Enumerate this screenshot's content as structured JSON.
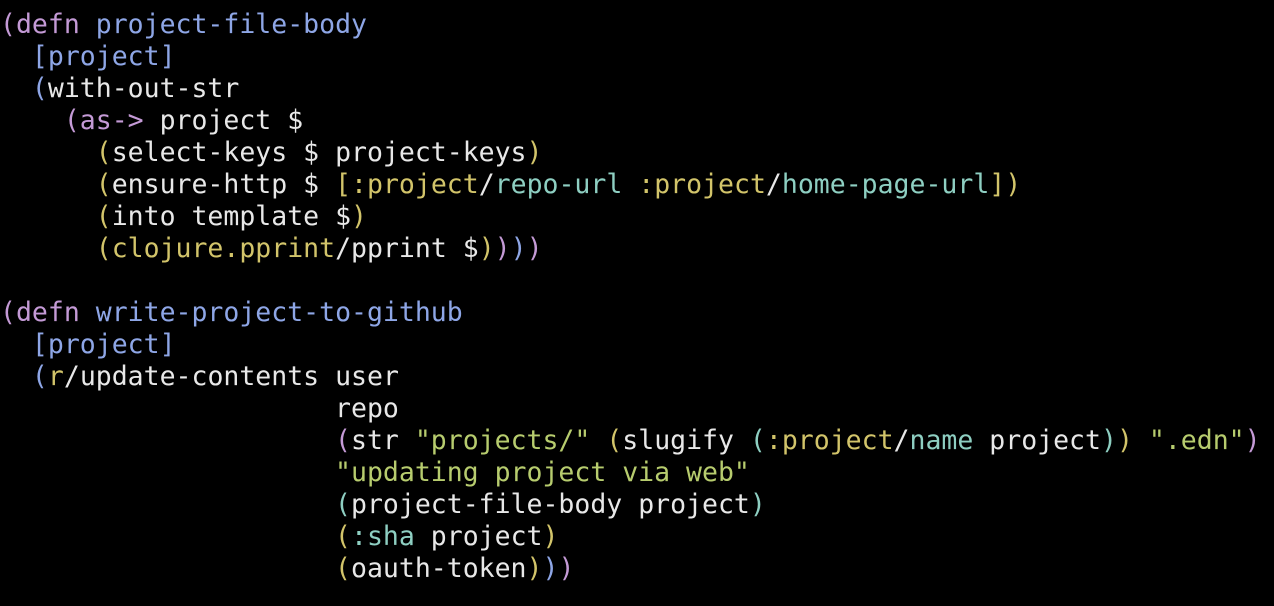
{
  "editor": {
    "language": "clojure",
    "background": "#000000",
    "palette": {
      "plain": "#e8e8e8",
      "paren_depth_1": "#c49ad6",
      "paren_depth_2": "#8ea6e6",
      "paren_depth_3": "#c49ad6",
      "paren_depth_4": "#d2c46a",
      "paren_depth_5": "#8ecfc2",
      "paren_depth_6": "#d2c46a",
      "keyword_namespace": "#d2c46a",
      "keyword_name": "#8ecfc2",
      "defined_name": "#8ea6e6",
      "string": "#b7cc6e"
    },
    "lines": [
      [
        {
          "text": "(",
          "color": "#c49ad6",
          "role": "paren"
        },
        {
          "text": "defn ",
          "color": "#c49ad6",
          "role": "special-form"
        },
        {
          "text": "project-file-body",
          "color": "#8ea6e6",
          "role": "function-name"
        }
      ],
      [
        {
          "text": "  ",
          "color": "#e8e8e8",
          "role": "indent"
        },
        {
          "text": "[",
          "color": "#8ea6e6",
          "role": "bracket"
        },
        {
          "text": "project",
          "color": "#8ea6e6",
          "role": "symbol"
        },
        {
          "text": "]",
          "color": "#8ea6e6",
          "role": "bracket"
        }
      ],
      [
        {
          "text": "  ",
          "color": "#e8e8e8",
          "role": "indent"
        },
        {
          "text": "(",
          "color": "#8ea6e6",
          "role": "paren"
        },
        {
          "text": "with-out-str",
          "color": "#e8e8e8",
          "role": "symbol"
        }
      ],
      [
        {
          "text": "    ",
          "color": "#e8e8e8",
          "role": "indent"
        },
        {
          "text": "(",
          "color": "#c49ad6",
          "role": "paren"
        },
        {
          "text": "as->",
          "color": "#c49ad6",
          "role": "special-form"
        },
        {
          "text": " project $",
          "color": "#e8e8e8",
          "role": "symbol"
        }
      ],
      [
        {
          "text": "      ",
          "color": "#e8e8e8",
          "role": "indent"
        },
        {
          "text": "(",
          "color": "#d2c46a",
          "role": "paren"
        },
        {
          "text": "select-keys $ project-keys",
          "color": "#e8e8e8",
          "role": "symbol"
        },
        {
          "text": ")",
          "color": "#d2c46a",
          "role": "paren"
        }
      ],
      [
        {
          "text": "      ",
          "color": "#e8e8e8",
          "role": "indent"
        },
        {
          "text": "(",
          "color": "#d2c46a",
          "role": "paren"
        },
        {
          "text": "ensure-http $ ",
          "color": "#e8e8e8",
          "role": "symbol"
        },
        {
          "text": "[",
          "color": "#d2c46a",
          "role": "bracket"
        },
        {
          "text": ":project",
          "color": "#d2c46a",
          "role": "keyword-ns"
        },
        {
          "text": "/",
          "color": "#e8e8e8",
          "role": "separator"
        },
        {
          "text": "repo-url",
          "color": "#8ecfc2",
          "role": "keyword-name"
        },
        {
          "text": " ",
          "color": "#e8e8e8",
          "role": "space"
        },
        {
          "text": ":project",
          "color": "#d2c46a",
          "role": "keyword-ns"
        },
        {
          "text": "/",
          "color": "#e8e8e8",
          "role": "separator"
        },
        {
          "text": "home-page-url",
          "color": "#8ecfc2",
          "role": "keyword-name"
        },
        {
          "text": "]",
          "color": "#d2c46a",
          "role": "bracket"
        },
        {
          "text": ")",
          "color": "#d2c46a",
          "role": "paren"
        }
      ],
      [
        {
          "text": "      ",
          "color": "#e8e8e8",
          "role": "indent"
        },
        {
          "text": "(",
          "color": "#d2c46a",
          "role": "paren"
        },
        {
          "text": "into template $",
          "color": "#e8e8e8",
          "role": "symbol"
        },
        {
          "text": ")",
          "color": "#d2c46a",
          "role": "paren"
        }
      ],
      [
        {
          "text": "      ",
          "color": "#e8e8e8",
          "role": "indent"
        },
        {
          "text": "(",
          "color": "#d2c46a",
          "role": "paren"
        },
        {
          "text": "clojure.pprint",
          "color": "#d2c46a",
          "role": "namespace"
        },
        {
          "text": "/",
          "color": "#e8e8e8",
          "role": "separator"
        },
        {
          "text": "pprint $",
          "color": "#e8e8e8",
          "role": "symbol"
        },
        {
          "text": ")",
          "color": "#d2c46a",
          "role": "paren"
        },
        {
          "text": ")",
          "color": "#c49ad6",
          "role": "paren"
        },
        {
          "text": ")",
          "color": "#8ea6e6",
          "role": "paren"
        },
        {
          "text": ")",
          "color": "#c49ad6",
          "role": "paren"
        }
      ],
      [],
      [
        {
          "text": "(",
          "color": "#c49ad6",
          "role": "paren"
        },
        {
          "text": "defn ",
          "color": "#c49ad6",
          "role": "special-form"
        },
        {
          "text": "write-project-to-github",
          "color": "#8ea6e6",
          "role": "function-name"
        }
      ],
      [
        {
          "text": "  ",
          "color": "#e8e8e8",
          "role": "indent"
        },
        {
          "text": "[",
          "color": "#8ea6e6",
          "role": "bracket"
        },
        {
          "text": "project",
          "color": "#8ea6e6",
          "role": "symbol"
        },
        {
          "text": "]",
          "color": "#8ea6e6",
          "role": "bracket"
        }
      ],
      [
        {
          "text": "  ",
          "color": "#e8e8e8",
          "role": "indent"
        },
        {
          "text": "(",
          "color": "#8ea6e6",
          "role": "paren"
        },
        {
          "text": "r",
          "color": "#d2c46a",
          "role": "namespace"
        },
        {
          "text": "/update-contents user",
          "color": "#e8e8e8",
          "role": "symbol"
        }
      ],
      [
        {
          "text": "                     ",
          "color": "#e8e8e8",
          "role": "indent"
        },
        {
          "text": "repo",
          "color": "#e8e8e8",
          "role": "symbol"
        }
      ],
      [
        {
          "text": "                     ",
          "color": "#e8e8e8",
          "role": "indent"
        },
        {
          "text": "(",
          "color": "#c49ad6",
          "role": "paren"
        },
        {
          "text": "str ",
          "color": "#e8e8e8",
          "role": "symbol"
        },
        {
          "text": "\"projects/\"",
          "color": "#b7cc6e",
          "role": "string"
        },
        {
          "text": " ",
          "color": "#e8e8e8",
          "role": "space"
        },
        {
          "text": "(",
          "color": "#d2c46a",
          "role": "paren"
        },
        {
          "text": "slugify ",
          "color": "#e8e8e8",
          "role": "symbol"
        },
        {
          "text": "(",
          "color": "#8ecfc2",
          "role": "paren"
        },
        {
          "text": ":project",
          "color": "#d2c46a",
          "role": "keyword-ns"
        },
        {
          "text": "/",
          "color": "#e8e8e8",
          "role": "separator"
        },
        {
          "text": "name",
          "color": "#8ecfc2",
          "role": "keyword-name"
        },
        {
          "text": " project",
          "color": "#e8e8e8",
          "role": "symbol"
        },
        {
          "text": ")",
          "color": "#8ecfc2",
          "role": "paren"
        },
        {
          "text": ")",
          "color": "#d2c46a",
          "role": "paren"
        },
        {
          "text": " ",
          "color": "#e8e8e8",
          "role": "space"
        },
        {
          "text": "\".edn\"",
          "color": "#b7cc6e",
          "role": "string"
        },
        {
          "text": ")",
          "color": "#c49ad6",
          "role": "paren"
        }
      ],
      [
        {
          "text": "                     ",
          "color": "#e8e8e8",
          "role": "indent"
        },
        {
          "text": "\"updating project via web\"",
          "color": "#b7cc6e",
          "role": "string"
        }
      ],
      [
        {
          "text": "                     ",
          "color": "#e8e8e8",
          "role": "indent"
        },
        {
          "text": "(",
          "color": "#8ecfc2",
          "role": "paren"
        },
        {
          "text": "project-file-body project",
          "color": "#e8e8e8",
          "role": "symbol"
        },
        {
          "text": ")",
          "color": "#8ecfc2",
          "role": "paren"
        }
      ],
      [
        {
          "text": "                     ",
          "color": "#e8e8e8",
          "role": "indent"
        },
        {
          "text": "(",
          "color": "#d2c46a",
          "role": "paren"
        },
        {
          "text": ":sha",
          "color": "#8ecfc2",
          "role": "keyword"
        },
        {
          "text": " project",
          "color": "#e8e8e8",
          "role": "symbol"
        },
        {
          "text": ")",
          "color": "#d2c46a",
          "role": "paren"
        }
      ],
      [
        {
          "text": "                     ",
          "color": "#e8e8e8",
          "role": "indent"
        },
        {
          "text": "(",
          "color": "#d2c46a",
          "role": "paren"
        },
        {
          "text": "oauth-token",
          "color": "#e8e8e8",
          "role": "symbol"
        },
        {
          "text": ")",
          "color": "#d2c46a",
          "role": "paren"
        },
        {
          "text": ")",
          "color": "#8ea6e6",
          "role": "paren"
        },
        {
          "text": ")",
          "color": "#c49ad6",
          "role": "paren"
        }
      ]
    ]
  }
}
